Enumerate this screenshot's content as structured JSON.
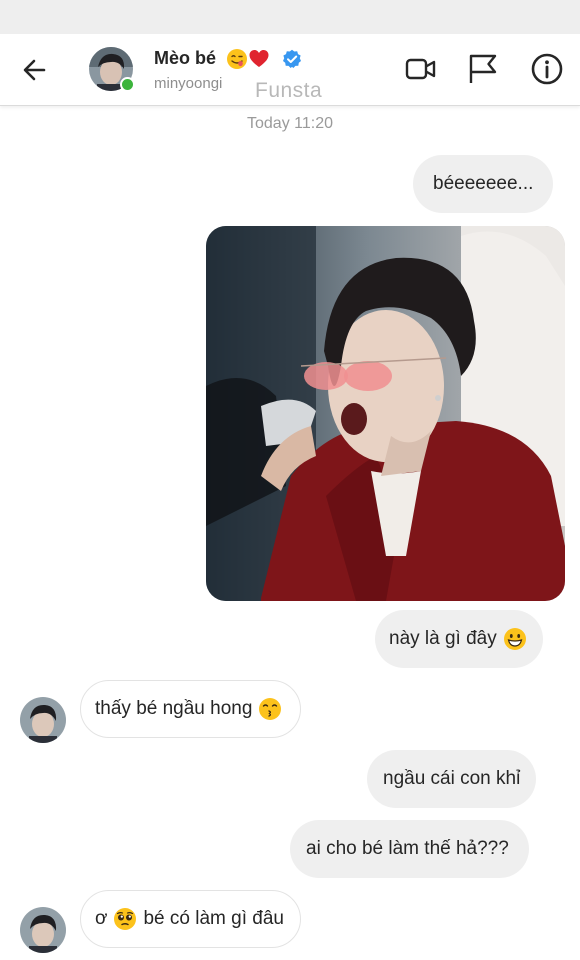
{
  "header": {
    "contact_name": "Mèo bé",
    "username": "minyoongi",
    "account_label": "Funsta",
    "name_emojis": [
      "face-savoring-food-emoji",
      "red-heart-emoji",
      "verified-badge-icon"
    ],
    "icons": [
      "back-arrow-icon",
      "video-call-icon",
      "flag-icon",
      "info-icon"
    ],
    "online": true,
    "accent": "#3897f0",
    "online_color": "#3cb43c"
  },
  "thread": {
    "timestamp": "Today 11:20",
    "messages": [
      {
        "side": "outgoing",
        "text": "béeeeeee..."
      },
      {
        "side": "outgoing",
        "type": "photo",
        "icon": "photo-image"
      },
      {
        "side": "outgoing",
        "text": "này là gì đây",
        "emoji": "grinning-face-emoji"
      },
      {
        "side": "incoming",
        "text": "thấy bé ngầu hong",
        "emoji": "kissing-face-emoji"
      },
      {
        "side": "outgoing",
        "text": "ngầu cái con khỉ"
      },
      {
        "side": "outgoing",
        "text": "ai cho bé làm thế hả???"
      },
      {
        "side": "incoming",
        "text_before": "ơ",
        "emoji": "pleading-face-emoji",
        "text_after": "bé có làm gì đâu"
      }
    ]
  }
}
